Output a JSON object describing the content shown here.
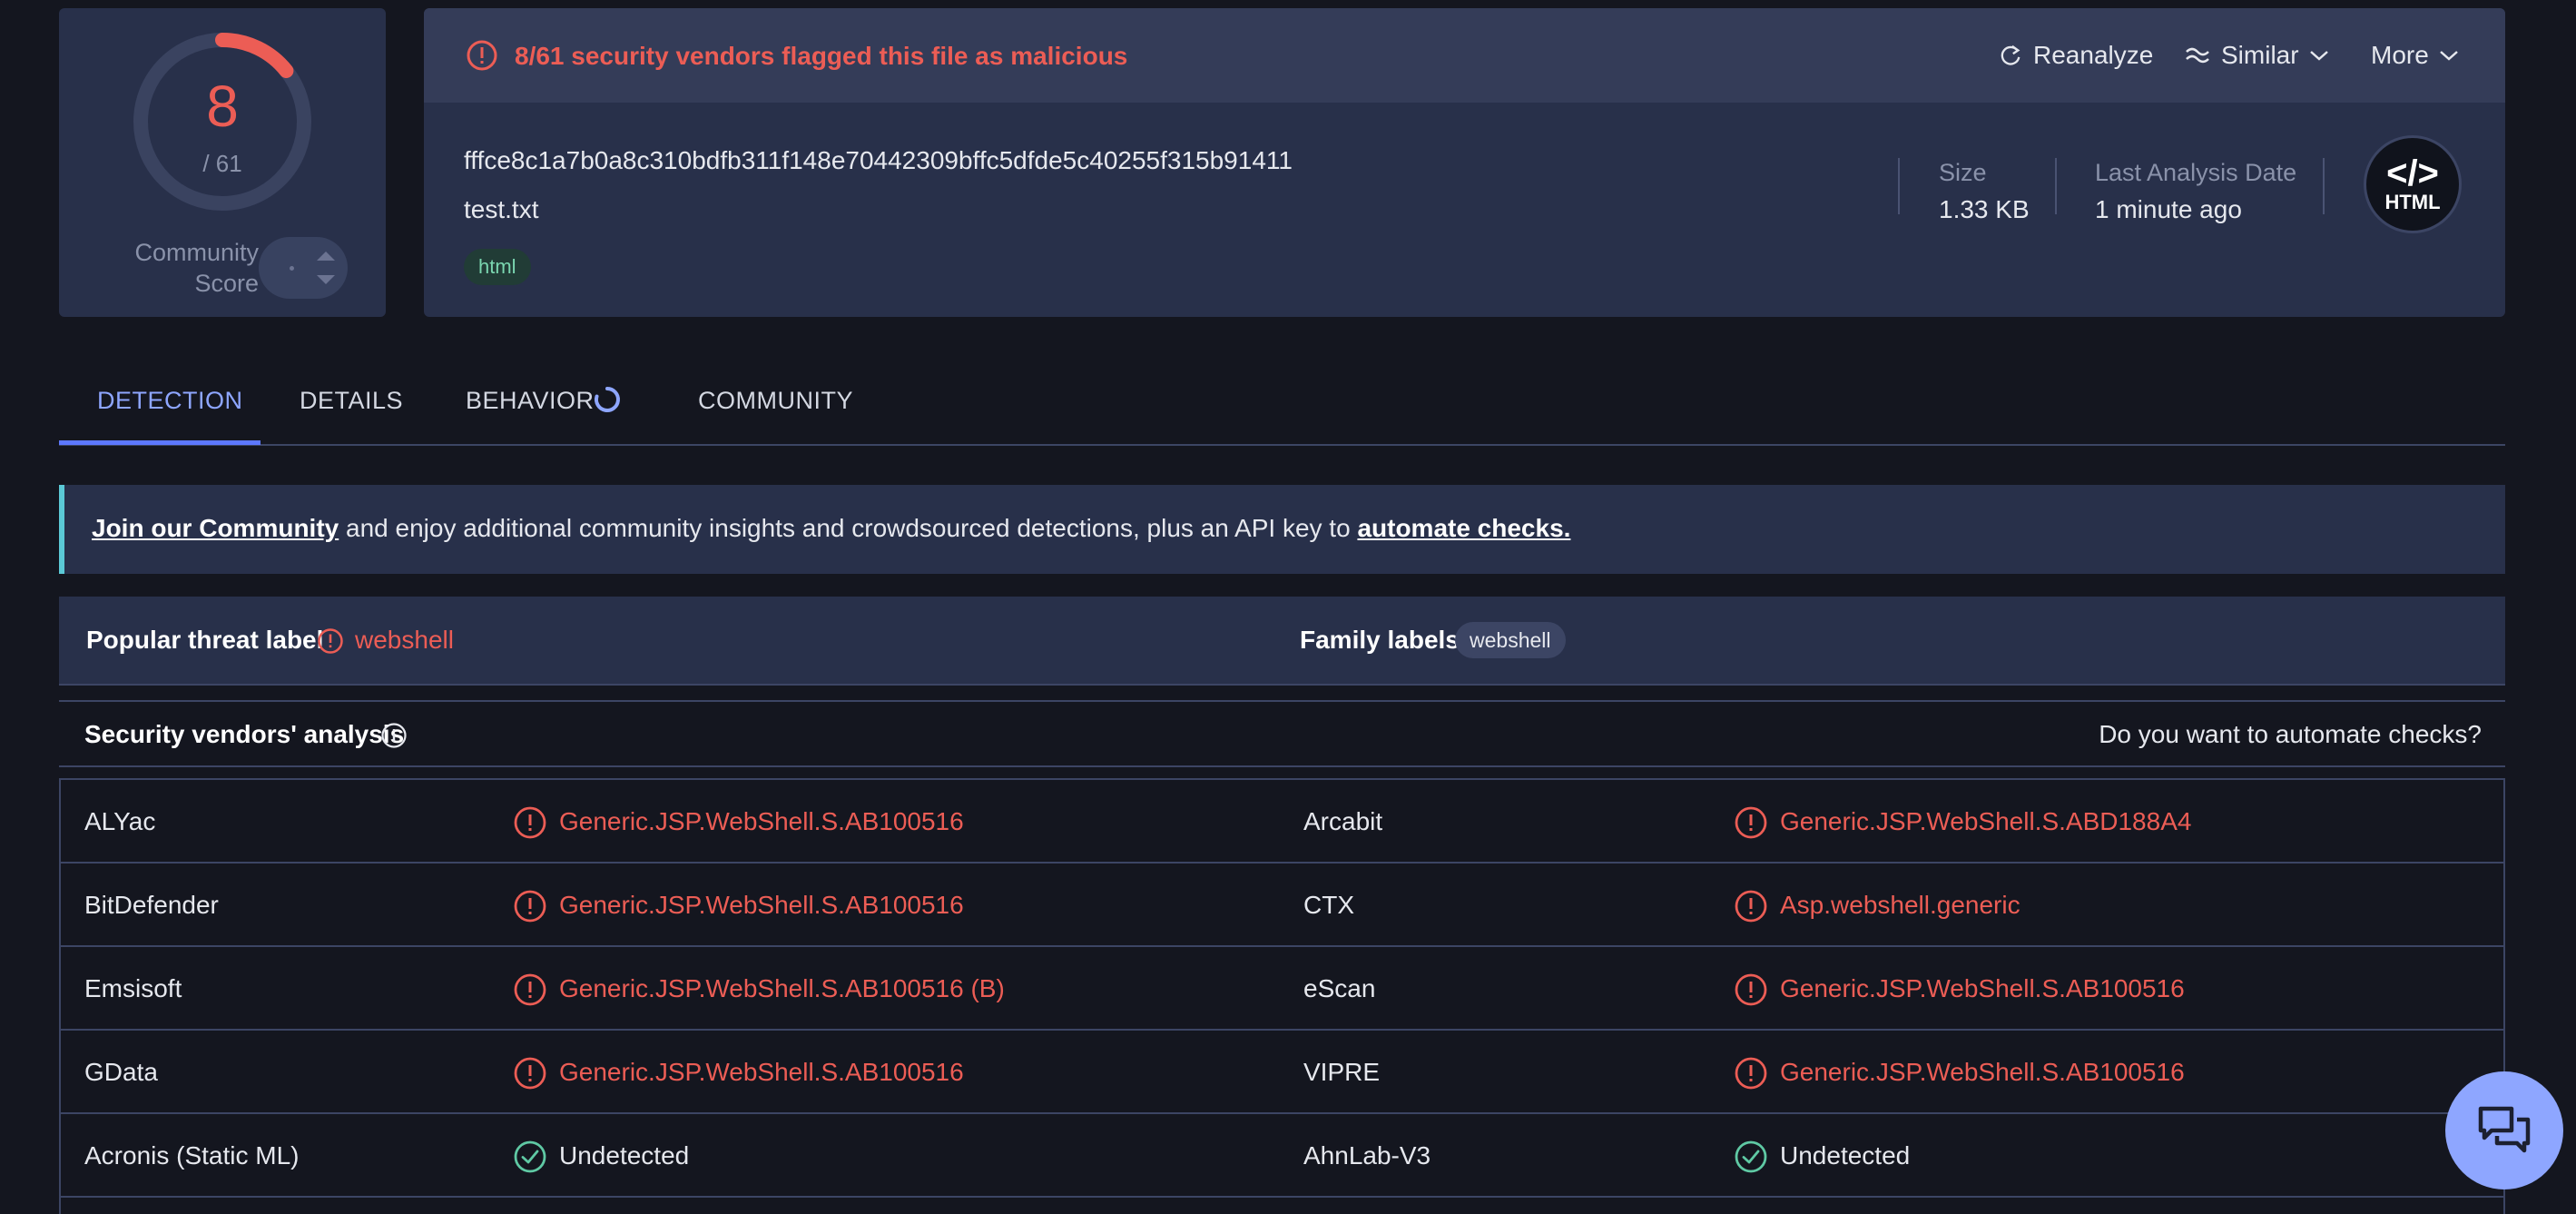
{
  "score": {
    "detections": "8",
    "total": "/ 61",
    "community_label": "Community Score"
  },
  "summary": {
    "alert": "8/61 security vendors flagged this file as malicious",
    "actions": {
      "reanalyze": "Reanalyze",
      "similar": "Similar",
      "more": "More"
    },
    "hash": "fffce8c1a7b0a8c310bdfb311f148e70442309bffc5dfde5c40255f315b91411",
    "filename": "test.txt",
    "tag": "html",
    "size_label": "Size",
    "size_value": "1.33 KB",
    "date_label": "Last Analysis Date",
    "date_value": "1 minute ago",
    "badge_code": "</>",
    "badge_label": "HTML"
  },
  "tabs": {
    "detection": "DETECTION",
    "details": "DETAILS",
    "behavior": "BEHAVIOR",
    "community": "COMMUNITY"
  },
  "banner": {
    "link1": "Join our Community",
    "text": " and enjoy additional community insights and crowdsourced detections, plus an API key to ",
    "link2": "automate checks."
  },
  "threat": {
    "popular_label": "Popular threat label",
    "popular_value": "webshell",
    "family_label": "Family labels",
    "family_value": "webshell"
  },
  "vendors": {
    "title": "Security vendors' analysis",
    "automate": "Do you want to automate checks?",
    "rows": [
      [
        {
          "vendor": "ALYac",
          "result": "Generic.JSP.WebShell.S.AB100516"
        },
        {
          "vendor": "Arcabit",
          "result": "Generic.JSP.WebShell.S.ABD188A4"
        }
      ],
      [
        {
          "vendor": "BitDefender",
          "result": "Generic.JSP.WebShell.S.AB100516"
        },
        {
          "vendor": "CTX",
          "result": "Asp.webshell.generic"
        }
      ],
      [
        {
          "vendor": "Emsisoft",
          "result": "Generic.JSP.WebShell.S.AB100516 (B)"
        },
        {
          "vendor": "eScan",
          "result": "Generic.JSP.WebShell.S.AB100516"
        }
      ],
      [
        {
          "vendor": "GData",
          "result": "Generic.JSP.WebShell.S.AB100516"
        },
        {
          "vendor": "VIPRE",
          "result": "Generic.JSP.WebShell.S.AB100516"
        }
      ],
      [
        {
          "vendor": "Acronis (Static ML)",
          "result": "Undetected"
        },
        {
          "vendor": "AhnLab-V3",
          "result": "Undetected"
        }
      ]
    ]
  },
  "colors": {
    "malicious": "#ec5d55",
    "accent": "#5d78ff",
    "clean": "#5fc9a4"
  }
}
